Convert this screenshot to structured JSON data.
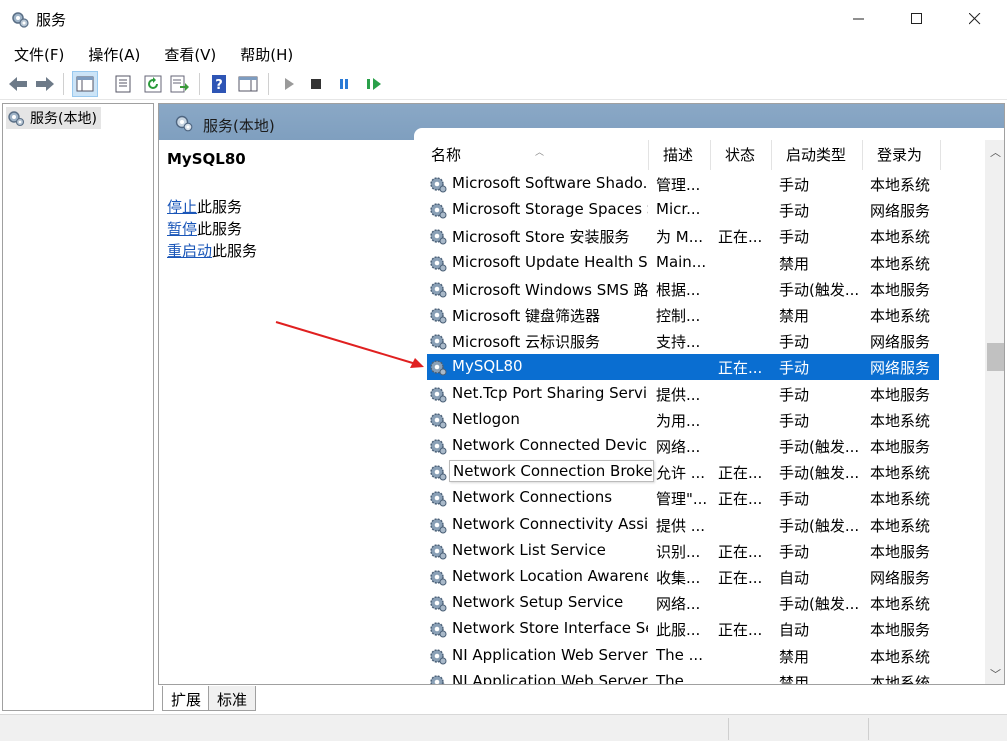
{
  "window": {
    "title": "服务",
    "minimize_icon": "minimize-icon",
    "maximize_icon": "maximize-icon",
    "close_icon": "close-icon"
  },
  "menu": [
    "文件(F)",
    "操作(A)",
    "查看(V)",
    "帮助(H)"
  ],
  "toolbar": {
    "buttons": [
      "back-icon",
      "forward-icon",
      "show-hide-tree-icon",
      "properties-icon",
      "refresh-icon",
      "export-list-icon",
      "help-icon",
      "show-hide-action-pane-icon",
      "start-service-icon",
      "stop-service-icon",
      "pause-service-icon",
      "restart-service-icon"
    ]
  },
  "tree": {
    "node_label": "服务(本地)"
  },
  "main": {
    "header_title": "服务(本地)",
    "selected_service": "MySQL80",
    "actions": [
      {
        "link": "停止",
        "rest": "此服务"
      },
      {
        "link": "暂停",
        "rest": "此服务"
      },
      {
        "link": "重启动",
        "rest": "此服务"
      }
    ]
  },
  "list": {
    "columns": [
      "名称",
      "描述",
      "状态",
      "启动类型",
      "登录为"
    ],
    "rows": [
      {
        "name": "Microsoft Software Shado...",
        "desc": "管理...",
        "status": "",
        "startup": "手动",
        "logon": "本地系统"
      },
      {
        "name": "Microsoft Storage Spaces S...",
        "desc": "Micr...",
        "status": "",
        "startup": "手动",
        "logon": "网络服务"
      },
      {
        "name": "Microsoft Store 安装服务",
        "desc": "为 M...",
        "status": "正在...",
        "startup": "手动",
        "logon": "本地系统"
      },
      {
        "name": "Microsoft Update Health S...",
        "desc": "Main...",
        "status": "",
        "startup": "禁用",
        "logon": "本地系统"
      },
      {
        "name": "Microsoft Windows SMS 路...",
        "desc": "根据...",
        "status": "",
        "startup": "手动(触发...",
        "logon": "本地服务"
      },
      {
        "name": "Microsoft 键盘筛选器",
        "desc": "控制...",
        "status": "",
        "startup": "禁用",
        "logon": "本地系统"
      },
      {
        "name": "Microsoft 云标识服务",
        "desc": "支持...",
        "status": "",
        "startup": "手动",
        "logon": "网络服务"
      },
      {
        "name": "MySQL80",
        "desc": "",
        "status": "正在...",
        "startup": "手动",
        "logon": "网络服务"
      },
      {
        "name": "Net.Tcp Port Sharing Service",
        "desc": "提供...",
        "status": "",
        "startup": "手动",
        "logon": "本地服务"
      },
      {
        "name": "Netlogon",
        "desc": "为用...",
        "status": "",
        "startup": "手动",
        "logon": "本地系统"
      },
      {
        "name": "Network Connected Devic...",
        "desc": "网络...",
        "status": "",
        "startup": "手动(触发...",
        "logon": "本地服务"
      },
      {
        "name": "Network Connection Broker",
        "desc": "允许 ...",
        "status": "正在...",
        "startup": "手动(触发...",
        "logon": "本地系统"
      },
      {
        "name": "Network Connections",
        "desc": "管理\"...",
        "status": "正在...",
        "startup": "手动",
        "logon": "本地系统"
      },
      {
        "name": "Network Connectivity Assis...",
        "desc": "提供 ...",
        "status": "",
        "startup": "手动(触发...",
        "logon": "本地系统"
      },
      {
        "name": "Network List Service",
        "desc": "识别...",
        "status": "正在...",
        "startup": "手动",
        "logon": "本地服务"
      },
      {
        "name": "Network Location Awarene...",
        "desc": "收集...",
        "status": "正在...",
        "startup": "自动",
        "logon": "网络服务"
      },
      {
        "name": "Network Setup Service",
        "desc": "网络...",
        "status": "",
        "startup": "手动(触发...",
        "logon": "本地系统"
      },
      {
        "name": "Network Store Interface Se...",
        "desc": "此服...",
        "status": "正在...",
        "startup": "自动",
        "logon": "本地服务"
      },
      {
        "name": "NI Application Web Server",
        "desc": "The ...",
        "status": "",
        "startup": "禁用",
        "logon": "本地系统"
      },
      {
        "name": "NI Application Web Server",
        "desc": "The ...",
        "status": "",
        "startup": "禁用",
        "logon": "本地系统"
      }
    ],
    "selected_index": 7,
    "tooltip_index": 11
  },
  "tabs": [
    "扩展",
    "标准"
  ],
  "colors": {
    "selection": "#0a6ed1",
    "header": "#8aa8c6",
    "annotation_arrow": "#e02020",
    "link": "#1a56b8"
  }
}
